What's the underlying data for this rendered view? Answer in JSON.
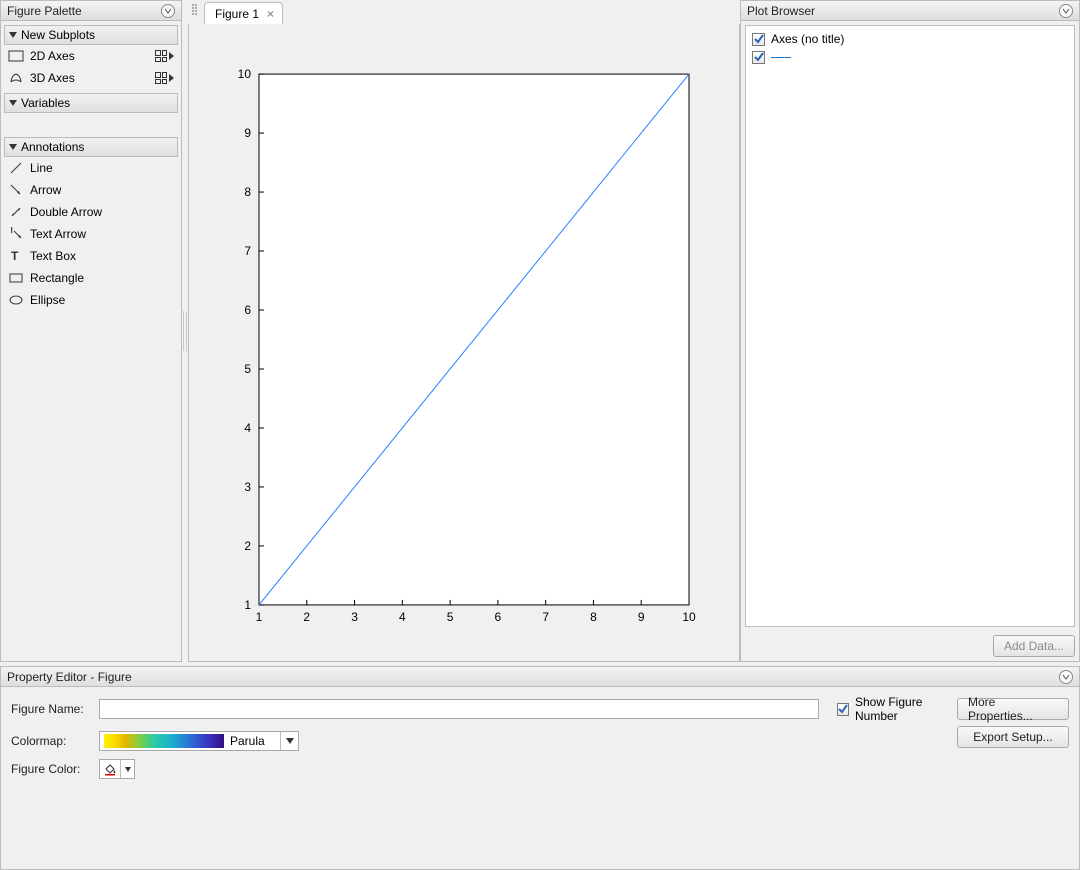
{
  "figure_palette": {
    "title": "Figure Palette",
    "sections": {
      "new_subplots": {
        "title": "New Subplots",
        "items": [
          "2D Axes",
          "3D Axes"
        ]
      },
      "variables": {
        "title": "Variables"
      },
      "annotations": {
        "title": "Annotations",
        "items": [
          "Line",
          "Arrow",
          "Double Arrow",
          "Text Arrow",
          "Text Box",
          "Rectangle",
          "Ellipse"
        ]
      }
    }
  },
  "tabs": {
    "active": "Figure 1"
  },
  "plot_browser": {
    "title": "Plot Browser",
    "items": [
      {
        "checked": true,
        "label": "Axes (no title)"
      },
      {
        "checked": true,
        "label": ""
      }
    ],
    "add_data": "Add Data..."
  },
  "property_editor": {
    "title": "Property Editor - Figure",
    "figure_name_label": "Figure Name:",
    "figure_name_value": "",
    "show_figure_number_label": "Show Figure Number",
    "show_figure_number_checked": true,
    "colormap_label": "Colormap:",
    "colormap_name": "Parula",
    "figure_color_label": "Figure Color:",
    "more_properties": "More Properties...",
    "export_setup": "Export Setup..."
  },
  "chart_data": {
    "type": "line",
    "x": [
      1,
      2,
      3,
      4,
      5,
      6,
      7,
      8,
      9,
      10
    ],
    "y": [
      1,
      2,
      3,
      4,
      5,
      6,
      7,
      8,
      9,
      10
    ],
    "xlim": [
      1,
      10
    ],
    "ylim": [
      1,
      10
    ],
    "xticks": [
      1,
      2,
      3,
      4,
      5,
      6,
      7,
      8,
      9,
      10
    ],
    "yticks": [
      1,
      2,
      3,
      4,
      5,
      6,
      7,
      8,
      9,
      10
    ],
    "title": "",
    "xlabel": "",
    "ylabel": "",
    "line_color": "#2a7fff"
  }
}
